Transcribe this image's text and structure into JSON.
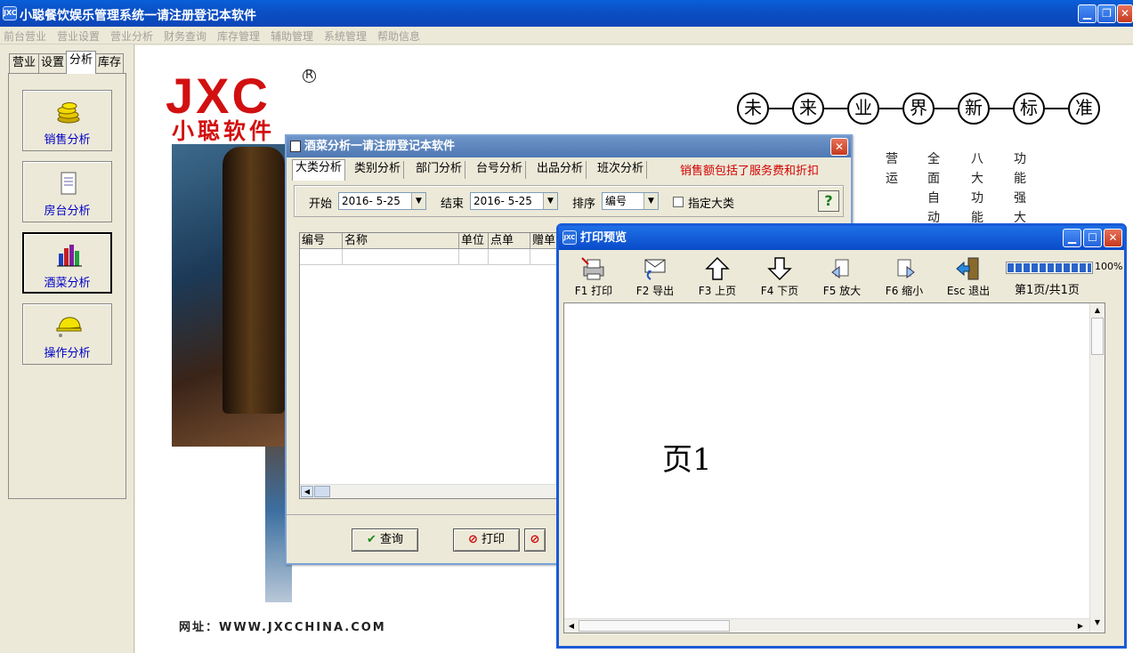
{
  "app": {
    "title": "小聪餐饮娱乐管理系统一请注册登记本软件",
    "icon_text": "JXC"
  },
  "menu": [
    "前台营业",
    "营业设置",
    "营业分析",
    "财务查询",
    "库存管理",
    "辅助管理",
    "系统管理",
    "帮助信息"
  ],
  "left_tabs": [
    "营业",
    "设置",
    "分析",
    "库存"
  ],
  "left_buttons": [
    {
      "label": "销售分析",
      "icon": "coins-icon"
    },
    {
      "label": "房台分析",
      "icon": "document-icon"
    },
    {
      "label": "酒菜分析",
      "icon": "bar-chart-icon",
      "selected": true
    },
    {
      "label": "操作分析",
      "icon": "helmet-icon"
    }
  ],
  "background": {
    "logo": "JXC",
    "logo_mark": "R",
    "logo_cn": "小聪软件",
    "slogan": [
      "未",
      "来",
      "业",
      "界",
      "新",
      "标",
      "准"
    ],
    "vertical_text": [
      "营运",
      "全面自动",
      "八大功能",
      "功能强大"
    ],
    "website": "网址：WWW.JXCCHINA.COM"
  },
  "dialog": {
    "title": "酒菜分析一请注册登记本软件",
    "tabs": [
      "大类分析",
      "类别分析",
      "部门分析",
      "台号分析",
      "出品分析",
      "班次分析"
    ],
    "note": "销售额包括了服务费和折扣",
    "start_label": "开始",
    "start_value": "2016- 5-25",
    "end_label": "结束",
    "end_value": "2016- 5-25",
    "sort_label": "排序",
    "sort_value": "编号",
    "checkbox_label": "指定大类",
    "help": "?",
    "columns": [
      "编号",
      "名称",
      "单位",
      "点单",
      "赠单"
    ],
    "query_button": "查询",
    "print_button": "打印"
  },
  "preview": {
    "title": "打印预览",
    "tools": [
      {
        "key": "F1",
        "label": "打印",
        "icon": "printer-icon"
      },
      {
        "key": "F2",
        "label": "导出",
        "icon": "envelope-icon"
      },
      {
        "key": "F3",
        "label": "上页",
        "icon": "arrow-up-icon"
      },
      {
        "key": "F4",
        "label": "下页",
        "icon": "arrow-down-icon"
      },
      {
        "key": "F5",
        "label": "放大",
        "icon": "zoom-in-icon"
      },
      {
        "key": "F6",
        "label": "缩小",
        "icon": "zoom-out-icon"
      },
      {
        "key": "Esc",
        "label": "退出",
        "icon": "exit-door-icon"
      }
    ],
    "zoom": "100%",
    "zoom_level": 1.0,
    "page_info": "第1页/共1页",
    "page_text": "页1"
  },
  "colors": {
    "title_blue": "#0a4fc4",
    "label_blue": "#0000c8",
    "note_red": "#d20000",
    "logo_red": "#d21010"
  }
}
